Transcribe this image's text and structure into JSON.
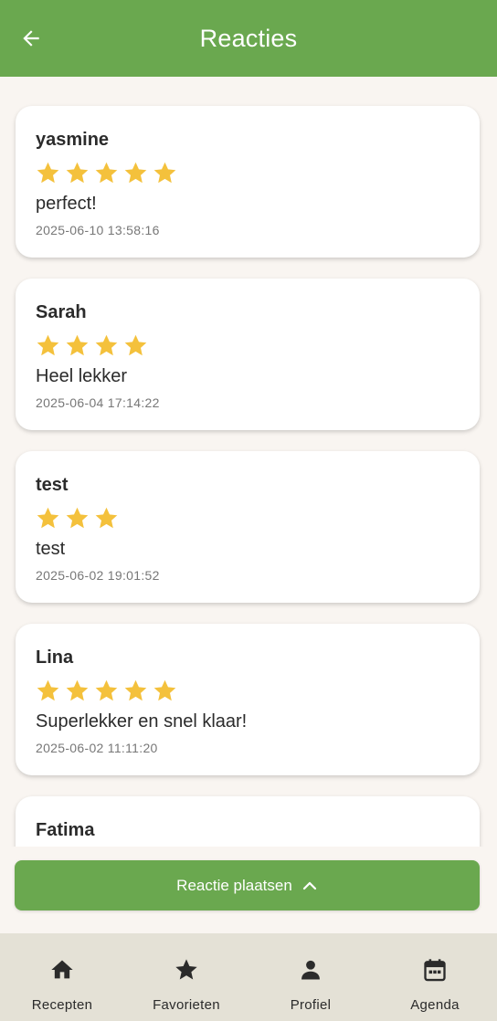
{
  "header": {
    "title": "Reacties",
    "back_icon": "arrow-left-icon"
  },
  "comments": [
    {
      "author": "yasmine",
      "rating": 5,
      "text": "perfect!",
      "date": "2025-06-10 13:58:16"
    },
    {
      "author": "Sarah",
      "rating": 4,
      "text": "Heel lekker",
      "date": "2025-06-04 17:14:22"
    },
    {
      "author": "test",
      "rating": 3,
      "text": "test",
      "date": "2025-06-02 19:01:52"
    },
    {
      "author": "Lina",
      "rating": 5,
      "text": "Superlekker en snel klaar!",
      "date": "2025-06-02 11:11:20"
    },
    {
      "author": "Fatima",
      "rating": 0,
      "text": "",
      "date": ""
    }
  ],
  "post_button": {
    "label": "Reactie plaatsen",
    "icon": "chevron-up-icon"
  },
  "nav": {
    "items": [
      {
        "label": "Recepten",
        "icon": "home-icon"
      },
      {
        "label": "Favorieten",
        "icon": "star-icon"
      },
      {
        "label": "Profiel",
        "icon": "person-icon"
      },
      {
        "label": "Agenda",
        "icon": "calendar-icon"
      }
    ]
  },
  "colors": {
    "primary": "#6aa84f",
    "background": "#f9f5f1",
    "star": "#f4c13c",
    "nav_background": "#e4e1d6"
  }
}
